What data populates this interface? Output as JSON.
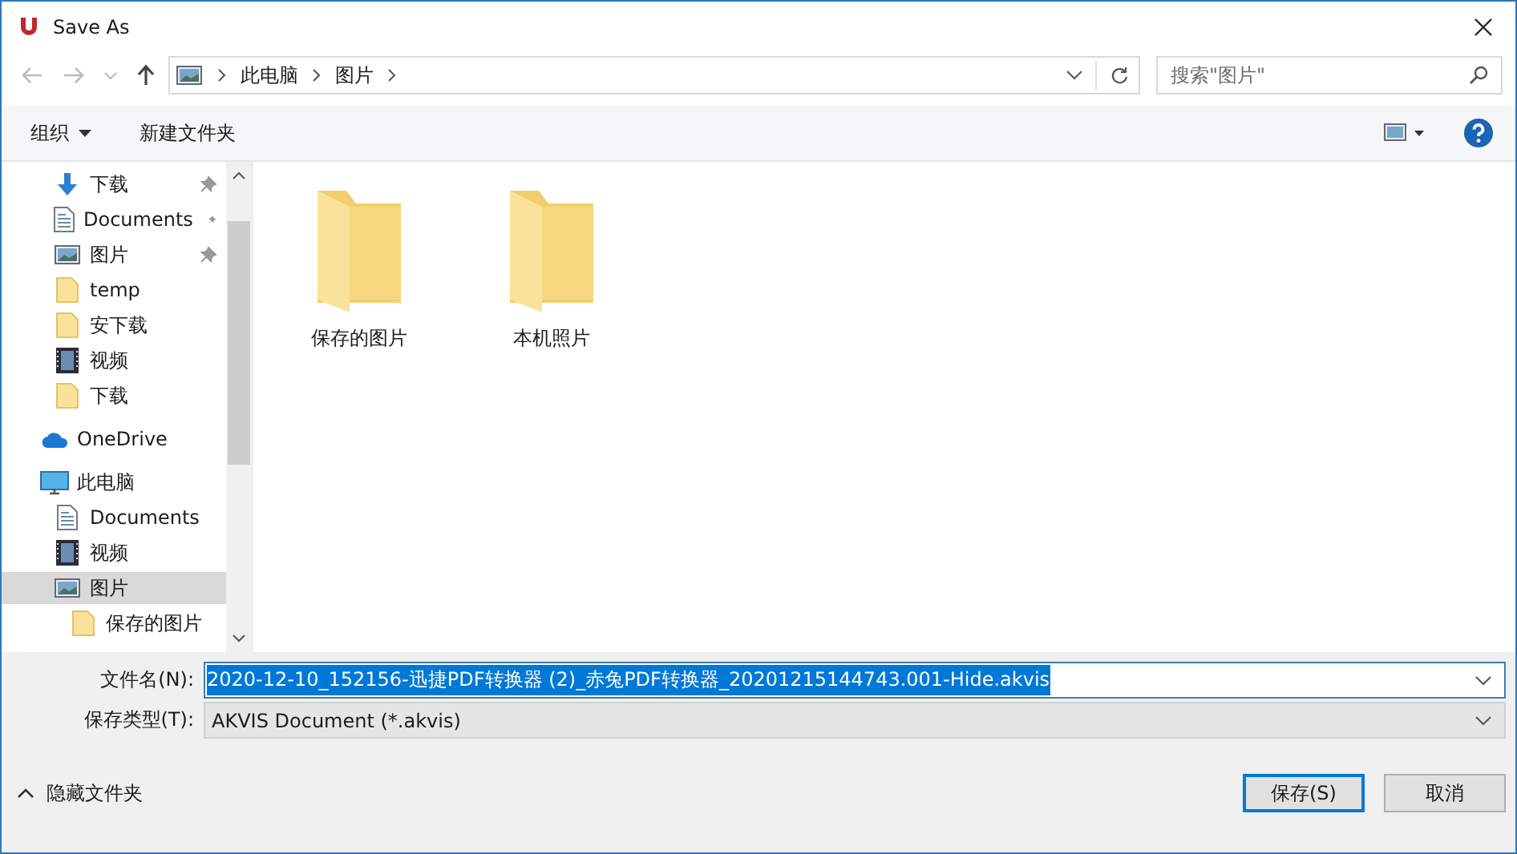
{
  "window": {
    "title": "Save As"
  },
  "address": {
    "segments": [
      "此电脑",
      "图片"
    ]
  },
  "search": {
    "placeholder": "搜索\"图片\""
  },
  "toolbar": {
    "organize": "组织",
    "new_folder": "新建文件夹"
  },
  "sidebar": {
    "items": [
      {
        "label": "下载",
        "kind": "download",
        "pinned": true,
        "selected": false
      },
      {
        "label": "Documents",
        "kind": "document",
        "pinned": true,
        "selected": false
      },
      {
        "label": "图片",
        "kind": "pictures",
        "pinned": true,
        "selected": false
      },
      {
        "label": "temp",
        "kind": "folder",
        "pinned": false,
        "selected": false
      },
      {
        "label": "安下载",
        "kind": "folder",
        "pinned": false,
        "selected": false
      },
      {
        "label": "视频",
        "kind": "video",
        "pinned": false,
        "selected": false
      },
      {
        "label": "下载",
        "kind": "folder",
        "pinned": false,
        "selected": false
      },
      {
        "label": "OneDrive",
        "kind": "cloud",
        "pinned": false,
        "selected": false
      },
      {
        "label": "此电脑",
        "kind": "computer",
        "pinned": false,
        "selected": false,
        "children": [
          {
            "label": "Documents",
            "kind": "document",
            "pinned": false,
            "selected": false
          },
          {
            "label": "视频",
            "kind": "video",
            "pinned": false,
            "selected": false
          },
          {
            "label": "图片",
            "kind": "pictures",
            "pinned": false,
            "selected": true,
            "children": [
              {
                "label": "保存的图片",
                "kind": "folder",
                "pinned": false,
                "selected": false
              }
            ]
          }
        ]
      }
    ]
  },
  "files": [
    {
      "name": "保存的图片"
    },
    {
      "name": "本机照片"
    }
  ],
  "form": {
    "file_name_label": "文件名(N):",
    "file_name": "2020-12-10_152156-迅捷PDF转换器 (2)_赤兔PDF转换器_20201215144743.001-Hide.akvis",
    "file_name_highlighted": true,
    "type_label": "保存类型(T):",
    "type_value": "AKVIS Document (*.akvis)"
  },
  "hide_folders": "隐藏文件夹",
  "buttons": [
    {
      "label": "保存(S)",
      "default": true
    },
    {
      "label": "取消",
      "default": false
    }
  ]
}
